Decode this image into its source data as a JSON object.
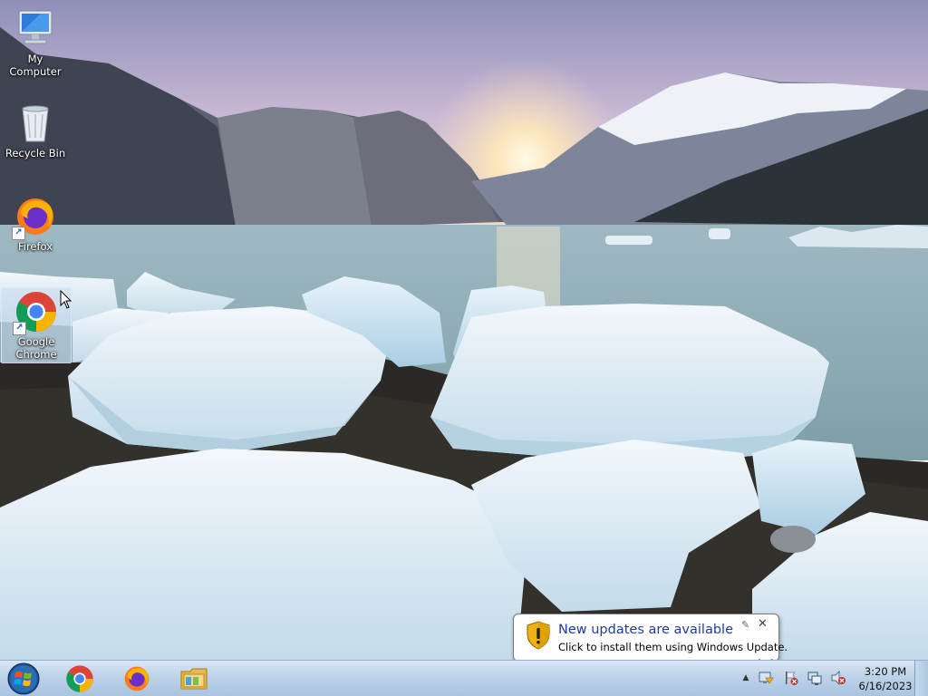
{
  "desktop": {
    "icons": [
      {
        "label": "My Computer",
        "icon": "computer-icon"
      },
      {
        "label": "Recycle Bin",
        "icon": "recycle-bin-icon"
      },
      {
        "label": "Firefox",
        "icon": "firefox-icon"
      },
      {
        "label": "Google Chrome",
        "icon": "chrome-icon",
        "selected": true
      }
    ]
  },
  "notification": {
    "title": "New updates are available",
    "text": "Click to install them using Windows Update.",
    "icon": "shield-warning-icon",
    "options_glyph": "✎",
    "close_glyph": "✕"
  },
  "taskbar": {
    "start": "windows-start-orb-icon",
    "pinned": [
      "chrome-icon",
      "firefox-icon",
      "file-explorer-icon"
    ],
    "tray": {
      "expand_glyph": "▲",
      "icons": [
        "windows-update-icon",
        "action-center-flag-icon",
        "network-icon",
        "volume-muted-icon"
      ],
      "time": "3:20 PM",
      "date": "6/16/2023"
    }
  },
  "colors": {
    "taskbar": "#bcd2e8",
    "balloon_title": "#1f3d9e"
  }
}
